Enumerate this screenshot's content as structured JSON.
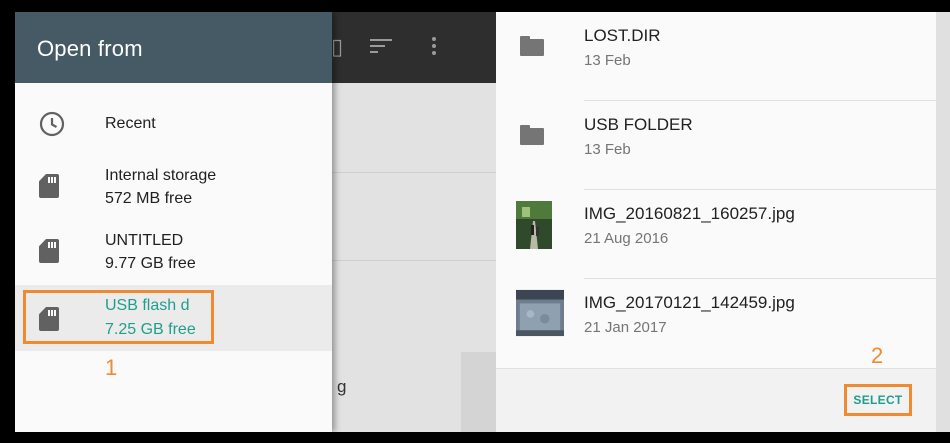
{
  "left": {
    "drawer_title": "Open from",
    "roots": [
      {
        "label": "Recent",
        "sub": "",
        "icon": "clock-icon"
      },
      {
        "label": "Internal storage",
        "sub": "572 MB free",
        "icon": "sd-card-icon"
      },
      {
        "label": "UNTITLED",
        "sub": "9.77 GB free",
        "icon": "sd-card-icon"
      },
      {
        "label": "USB flash d",
        "sub": "7.25 GB free",
        "icon": "sd-card-icon",
        "selected": true
      }
    ],
    "background_text": "g",
    "callout": "1"
  },
  "right": {
    "files": [
      {
        "name": "LOST.DIR",
        "date": "13 Feb",
        "type": "folder"
      },
      {
        "name": "USB FOLDER",
        "date": "13 Feb",
        "type": "folder"
      },
      {
        "name": "IMG_20160821_160257.jpg",
        "date": "21 Aug 2016",
        "type": "image"
      },
      {
        "name": "IMG_20170121_142459.jpg",
        "date": "21 Jan 2017",
        "type": "image"
      }
    ],
    "select_label": "SELECT",
    "callout": "2"
  },
  "colors": {
    "header": "#455a64",
    "accent": "#1f9e8e",
    "annotation": "#f08a31"
  }
}
